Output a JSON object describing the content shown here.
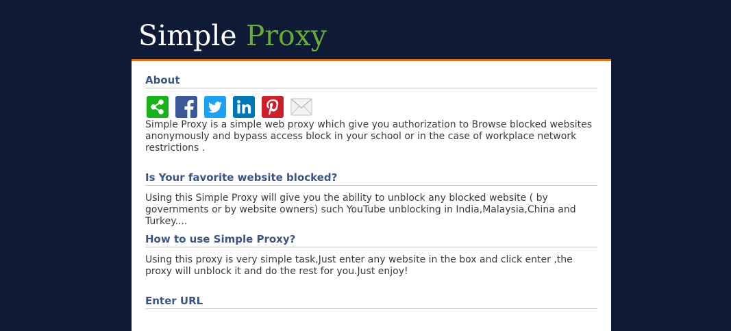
{
  "header": {
    "logo_word1": "Simple",
    "logo_word2": "Proxy"
  },
  "colors": {
    "background": "#0e1a36",
    "accent_bar": "#d9711f",
    "logo_green": "#6aaa3a",
    "heading_blue": "#3b5385"
  },
  "about": {
    "heading": "About",
    "share_buttons": [
      {
        "name": "share-icon",
        "color": "#19b319"
      },
      {
        "name": "facebook-icon",
        "color": "#3b5998"
      },
      {
        "name": "twitter-icon",
        "color": "#1da1f2"
      },
      {
        "name": "linkedin-icon",
        "color": "#0077b5"
      },
      {
        "name": "pinterest-icon",
        "color": "#cb2027"
      },
      {
        "name": "email-icon",
        "color": "#e6e6e6"
      }
    ],
    "text": "Simple Proxy is a simple web proxy which give you authorization to Browse blocked websites anonymously and bypass access block in your school or in the case of workplace network restrictions ."
  },
  "blocked": {
    "heading": "Is Your favorite website blocked?",
    "text": "Using this Simple Proxy will give you the ability to unblock any blocked website ( by governments or by website owners) such YouTube unblocking in India,Malaysia,China and Turkey...."
  },
  "how": {
    "heading": "How to use Simple Proxy?",
    "text": "Using this proxy is very simple task,Just enter any website in the box and click enter ,the proxy will unblock it and do the rest for you.Just enjoy!"
  },
  "url": {
    "heading": "Enter URL"
  }
}
